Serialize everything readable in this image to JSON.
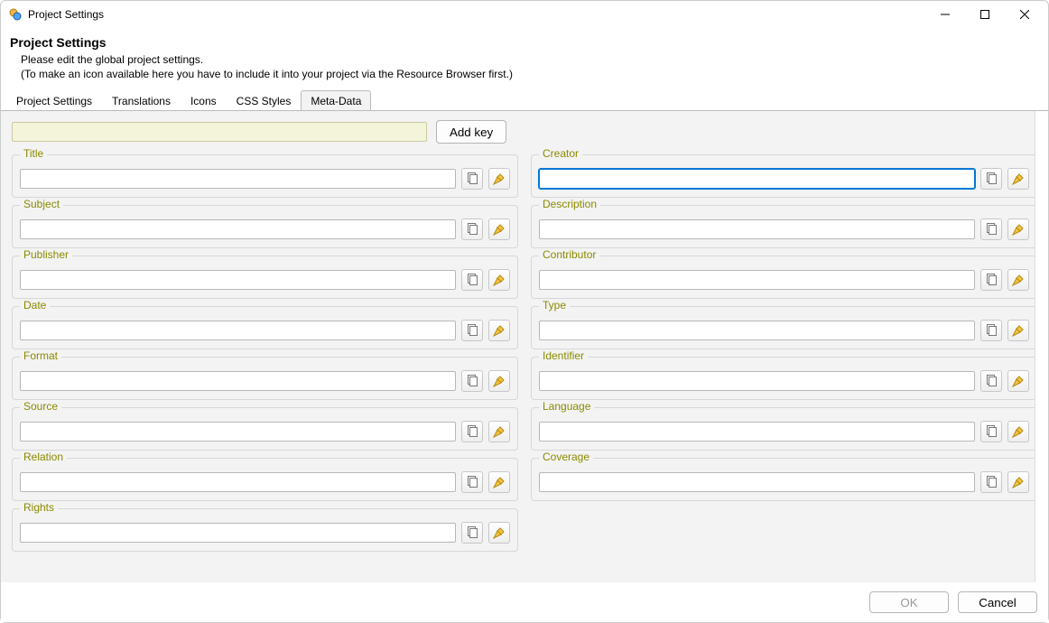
{
  "window": {
    "title": "Project Settings"
  },
  "header": {
    "heading": "Project Settings",
    "subtitle": "Please edit the global project settings.",
    "subnote": "(To make an icon available here you have to include it into your project via the Resource Browser first.)"
  },
  "tabs": [
    {
      "label": "Project Settings",
      "active": false
    },
    {
      "label": "Translations",
      "active": false
    },
    {
      "label": "Icons",
      "active": false
    },
    {
      "label": "CSS Styles",
      "active": false
    },
    {
      "label": "Meta-Data",
      "active": true
    }
  ],
  "keyrow": {
    "key_input_value": "",
    "add_key_label": "Add key"
  },
  "fields_left": [
    {
      "id": "title",
      "label": "Title",
      "value": ""
    },
    {
      "id": "subject",
      "label": "Subject",
      "value": ""
    },
    {
      "id": "publisher",
      "label": "Publisher",
      "value": ""
    },
    {
      "id": "date",
      "label": "Date",
      "value": ""
    },
    {
      "id": "format",
      "label": "Format",
      "value": ""
    },
    {
      "id": "source",
      "label": "Source",
      "value": ""
    },
    {
      "id": "relation",
      "label": "Relation",
      "value": ""
    },
    {
      "id": "rights",
      "label": "Rights",
      "value": ""
    }
  ],
  "fields_right": [
    {
      "id": "creator",
      "label": "Creator",
      "value": "",
      "focused": true
    },
    {
      "id": "description",
      "label": "Description",
      "value": ""
    },
    {
      "id": "contributor",
      "label": "Contributor",
      "value": ""
    },
    {
      "id": "type",
      "label": "Type",
      "value": ""
    },
    {
      "id": "identifier",
      "label": "Identifier",
      "value": ""
    },
    {
      "id": "language",
      "label": "Language",
      "value": ""
    },
    {
      "id": "coverage",
      "label": "Coverage",
      "value": ""
    }
  ],
  "icons": {
    "copy": "copy-icon",
    "clear": "broom-icon"
  },
  "footer": {
    "ok_label": "OK",
    "ok_enabled": false,
    "cancel_label": "Cancel"
  }
}
